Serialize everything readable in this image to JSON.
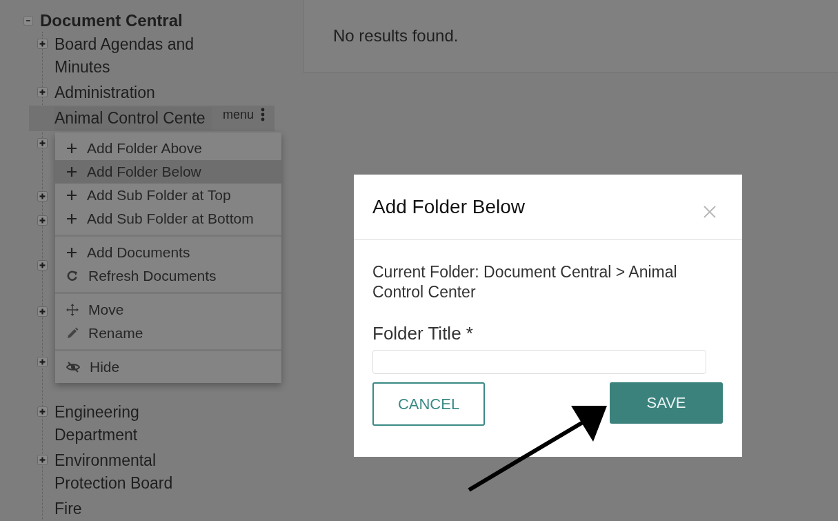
{
  "tree": {
    "label": "Document Central",
    "expanded": true,
    "children": [
      {
        "label": "Board Agendas and Minutes",
        "expanded": false,
        "selected": false
      },
      {
        "label": "Administration",
        "expanded": false,
        "selected": false
      },
      {
        "label": "Animal Control Cente",
        "selected": true,
        "menu_label": "menu"
      },
      {
        "expanded": false,
        "selected": false
      },
      {
        "expanded": false,
        "selected": false
      },
      {
        "expanded": false,
        "selected": false
      },
      {
        "expanded": false,
        "selected": false
      },
      {
        "expanded": false,
        "selected": false
      },
      {
        "expanded": false,
        "selected": false
      },
      {
        "label": "Engineering Department",
        "expanded": false,
        "selected": false
      },
      {
        "label": "Environmental Protection Board",
        "expanded": false,
        "selected": false
      },
      {
        "label": "Fire",
        "selected": false
      }
    ]
  },
  "context_menu": {
    "groups": [
      [
        {
          "label": "Add Folder Above",
          "kind": "plus",
          "selected": false
        },
        {
          "label": "Add Folder Below",
          "kind": "plus",
          "selected": true
        },
        {
          "label": "Add Sub Folder at Top",
          "kind": "plus",
          "selected": false
        },
        {
          "label": "Add Sub Folder at Bottom",
          "kind": "plus",
          "selected": false
        }
      ],
      [
        {
          "label": "Add Documents",
          "kind": "plus",
          "selected": false
        },
        {
          "label": "Refresh Documents",
          "kind": "refresh",
          "selected": false
        }
      ],
      [
        {
          "label": "Move",
          "kind": "move",
          "selected": false
        },
        {
          "label": "Rename",
          "kind": "pencil",
          "selected": false
        }
      ],
      [
        {
          "label": "Hide",
          "kind": "hide",
          "selected": false
        }
      ]
    ]
  },
  "results": {
    "message": "No results found."
  },
  "dialog": {
    "title": "Add Folder Below",
    "current_folder": "Current Folder: Document Central > Animal Control Center",
    "field_label": "Folder Title *",
    "buttons": [
      {
        "label": "CANCEL",
        "kind": "secondary"
      },
      {
        "label": "SAVE",
        "kind": "primary"
      }
    ]
  }
}
